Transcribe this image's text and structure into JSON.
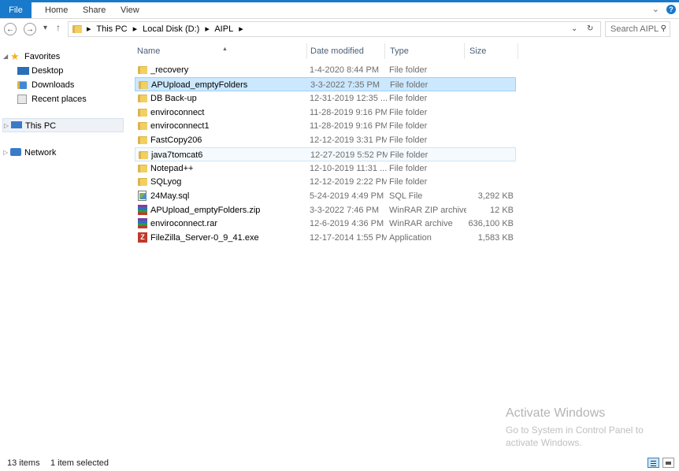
{
  "ribbon": {
    "tabs": [
      "File",
      "Home",
      "Share",
      "View"
    ]
  },
  "address": {
    "crumbs": [
      "This PC",
      "Local Disk (D:)",
      "AIPL"
    ],
    "search_placeholder": "Search AIPL"
  },
  "nav": {
    "favorites": "Favorites",
    "desktop": "Desktop",
    "downloads": "Downloads",
    "recent": "Recent places",
    "this_pc": "This PC",
    "network": "Network"
  },
  "columns": {
    "name": "Name",
    "date": "Date modified",
    "type": "Type",
    "size": "Size"
  },
  "files": [
    {
      "name": "_recovery",
      "date": "1-4-2020 8:44 PM",
      "type": "File folder",
      "size": "",
      "icon": "folder-icon"
    },
    {
      "name": "APUpload_emptyFolders",
      "date": "3-3-2022 7:35 PM",
      "type": "File folder",
      "size": "",
      "icon": "folder-icon"
    },
    {
      "name": "DB Back-up",
      "date": "12-31-2019 12:35 ...",
      "type": "File folder",
      "size": "",
      "icon": "folder-icon"
    },
    {
      "name": "enviroconnect",
      "date": "11-28-2019 9:16 PM",
      "type": "File folder",
      "size": "",
      "icon": "folder-icon"
    },
    {
      "name": "enviroconnect1",
      "date": "11-28-2019 9:16 PM",
      "type": "File folder",
      "size": "",
      "icon": "folder-icon"
    },
    {
      "name": "FastCopy206",
      "date": "12-12-2019 3:31 PM",
      "type": "File folder",
      "size": "",
      "icon": "folder-icon"
    },
    {
      "name": "java7tomcat6",
      "date": "12-27-2019 5:52 PM",
      "type": "File folder",
      "size": "",
      "icon": "folder-icon"
    },
    {
      "name": "Notepad++",
      "date": "12-10-2019 11:31 ...",
      "type": "File folder",
      "size": "",
      "icon": "folder-icon"
    },
    {
      "name": "SQLyog",
      "date": "12-12-2019 2:22 PM",
      "type": "File folder",
      "size": "",
      "icon": "folder-icon"
    },
    {
      "name": "24May.sql",
      "date": "5-24-2019 4:49 PM",
      "type": "SQL File",
      "size": "3,292 KB",
      "icon": "sql-file-icon"
    },
    {
      "name": "APUpload_emptyFolders.zip",
      "date": "3-3-2022 7:46 PM",
      "type": "WinRAR ZIP archive",
      "size": "12 KB",
      "icon": "winrar-icon"
    },
    {
      "name": "enviroconnect.rar",
      "date": "12-6-2019 4:36 PM",
      "type": "WinRAR archive",
      "size": "636,100 KB",
      "icon": "winrar-icon"
    },
    {
      "name": "FileZilla_Server-0_9_41.exe",
      "date": "12-17-2014 1:55 PM",
      "type": "Application",
      "size": "1,583 KB",
      "icon": "filezilla-icon"
    }
  ],
  "watermark": {
    "title": "Activate Windows",
    "body": "Go to System in Control Panel to activate Windows."
  },
  "status": {
    "count": "13 items",
    "selection": "1 item selected"
  },
  "colors": {
    "accent": "#1979ca",
    "selection": "#cce8ff",
    "selection_border": "#99d1ff"
  }
}
